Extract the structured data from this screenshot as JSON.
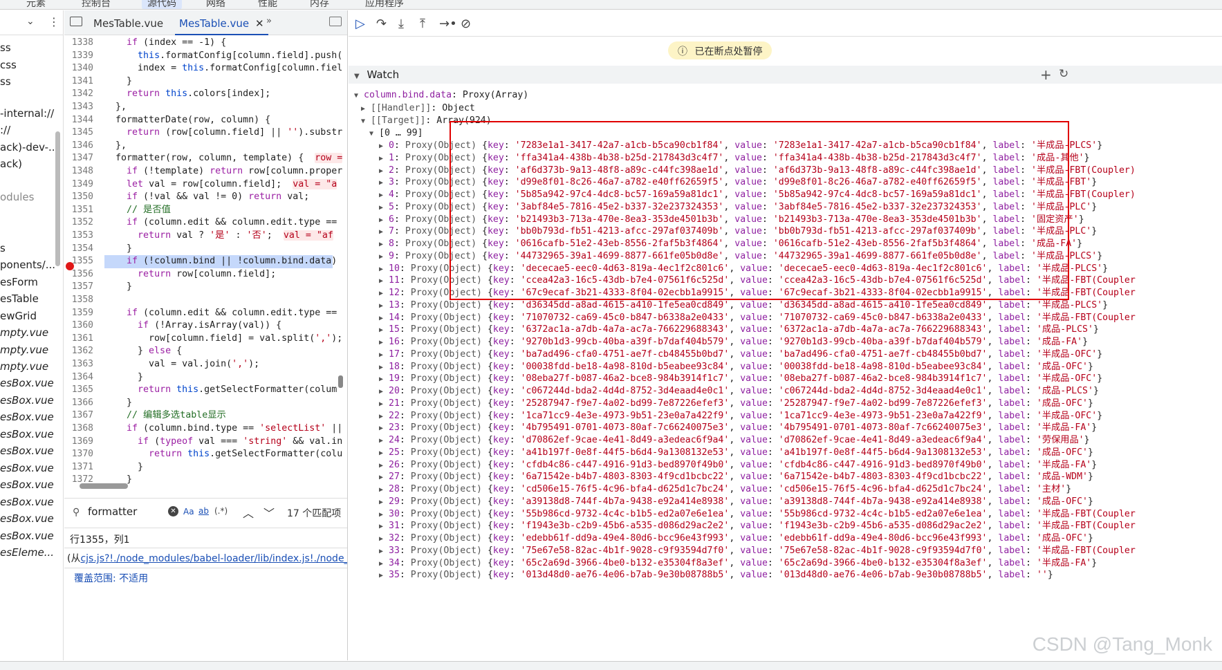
{
  "topbar": {
    "tabs": [
      "元素",
      "控制台",
      "源代码",
      "网络",
      "性能",
      "内存",
      "应用程序"
    ]
  },
  "file_tree": {
    "items": [
      "ss",
      "css",
      "ss",
      "-internal://",
      "://",
      "ack)-dev-...",
      "ack)",
      "odules",
      "s",
      "ponents/...",
      "esForm",
      "esTable",
      "ewGrid",
      "mpty.vue",
      "mpty.vue",
      "mpty.vue",
      "esBox.vue",
      "esBox.vue",
      "esBox.vue",
      "esBox.vue",
      "esBox.vue",
      "esBox.vue",
      "esBox.vue",
      "esBox.vue",
      "esBox.vue",
      "esBox.vue",
      "esEleme..."
    ]
  },
  "editor": {
    "tabs": [
      "MesTable.vue",
      "MesTable.vue"
    ],
    "lines": [
      [
        "1338",
        "    if (index == -1) {"
      ],
      [
        "1339",
        "      this.formatConfig[column.field].push("
      ],
      [
        "1340",
        "      index = this.formatConfig[column.fiel"
      ],
      [
        "1341",
        "    }"
      ],
      [
        "1342",
        "    return this.colors[index];"
      ],
      [
        "1343",
        "  },"
      ],
      [
        "1344",
        "  formatterDate(row, column) {"
      ],
      [
        "1345",
        "    return (row[column.field] || '').substr"
      ],
      [
        "1346",
        "  },"
      ],
      [
        "1347",
        "  formatter(row, column, template) {  row ="
      ],
      [
        "1348",
        "    if (!template) return row[column.proper"
      ],
      [
        "1349",
        "    let val = row[column.field];  val = \"a"
      ],
      [
        "1350",
        "    if (!val && val != 0) return val;"
      ],
      [
        "1351",
        "    // 是否值"
      ],
      [
        "1352",
        "    if (column.edit && column.edit.type =="
      ],
      [
        "1353",
        "      return val ? '是' : '否';  val = \"af"
      ],
      [
        "1354",
        "    }"
      ],
      [
        "1355",
        "    if (!column.bind || !column.bind.data)"
      ],
      [
        "1356",
        "      return row[column.field];"
      ],
      [
        "1357",
        "    }"
      ],
      [
        "1358",
        ""
      ],
      [
        "1359",
        "    if (column.edit && column.edit.type =="
      ],
      [
        "1360",
        "      if (!Array.isArray(val)) {"
      ],
      [
        "1361",
        "        row[column.field] = val.split(',');"
      ],
      [
        "1362",
        "      } else {"
      ],
      [
        "1363",
        "        val = val.join(',');"
      ],
      [
        "1364",
        "      }"
      ],
      [
        "1365",
        "      return this.getSelectFormatter(colum"
      ],
      [
        "1366",
        "    }"
      ],
      [
        "1367",
        "    // 编辑多选table显示"
      ],
      [
        "1368",
        "    if (column.bind.type == 'selectList' ||"
      ],
      [
        "1369",
        "      if (typeof val === 'string' && val.in"
      ],
      [
        "1370",
        "        return this.getSelectFormatter(colu"
      ],
      [
        "1371",
        "      }"
      ],
      [
        "1372",
        "    }"
      ]
    ],
    "search": {
      "query": "formatter",
      "aa": "Aa",
      "ab": "ab",
      "regex": "(.*)",
      "count": "17 个匹配项"
    },
    "status_pos": "行1355，列1",
    "status_src_prefix": "(从",
    "status_src": "cjs.js?!./node_modules/babel-loader/lib/index.js!./node_mo",
    "coverage": "覆盖范围: 不适用"
  },
  "debugger": {
    "paused": "已在断点处暂停",
    "watch_title": "Watch",
    "expr": "column.bind.data",
    "expr_type": "Proxy(Array)",
    "handler": "[[Handler]]",
    "handler_type": "Object",
    "target": "[[Target]]",
    "target_type": "Array(924)",
    "range": "[0 … 99]",
    "entries": [
      [
        "0",
        "7283e1a1-3417-42a7-a1cb-b5ca90cb1f84",
        "半成品-PLCS"
      ],
      [
        "1",
        "ffa341a4-438b-4b38-b25d-217843d3c4f7",
        "成品-其他"
      ],
      [
        "2",
        "af6d373b-9a13-48f8-a89c-c44fc398ae1d",
        "半成品-FBT(Coupler)"
      ],
      [
        "3",
        "d99e8f01-8c26-46a7-a782-e40ff62659f5",
        "半成品-FBT"
      ],
      [
        "4",
        "5b85a942-97c4-4dc8-bc57-169a59a81dc1",
        "半成品-FBT(Coupler)"
      ],
      [
        "5",
        "3abf84e5-7816-45e2-b337-32e237324353",
        "半成品-PLC"
      ],
      [
        "6",
        "b21493b3-713a-470e-8ea3-353de4501b3b",
        "固定资产"
      ],
      [
        "7",
        "bb0b793d-fb51-4213-afcc-297af037409b",
        "半成品-PLC"
      ],
      [
        "8",
        "0616cafb-51e2-43eb-8556-2faf5b3f4864",
        "成品-FA"
      ],
      [
        "9",
        "44732965-39a1-4699-8877-661fe05b0d8e",
        "半成品-PLCS"
      ],
      [
        "10",
        "dececae5-eec0-4d63-819a-4ec1f2c801c6",
        "半成品-PLCS"
      ],
      [
        "11",
        "ccea42a3-16c5-43db-b7e4-07561f6c525d",
        "半成品-FBT(Coupler"
      ],
      [
        "12",
        "67c9ecaf-3b21-4333-8f04-02ecbb1a9915",
        "半成品-FBT(Coupler"
      ],
      [
        "13",
        "d36345dd-a8ad-4615-a410-1fe5ea0cd849",
        "半成品-PLCS"
      ],
      [
        "14",
        "71070732-ca69-45c0-b847-b6338a2e0433",
        "半成品-FBT(Coupler"
      ],
      [
        "15",
        "6372ac1a-a7db-4a7a-ac7a-766229688343",
        "成品-PLCS"
      ],
      [
        "16",
        "9270b1d3-99cb-40ba-a39f-b7daf404b579",
        "成品-FA"
      ],
      [
        "17",
        "ba7ad496-cfa0-4751-ae7f-cb48455b0bd7",
        "半成品-OFC"
      ],
      [
        "18",
        "00038fdd-be18-4a98-810d-b5eabee93c84",
        "成品-OFC"
      ],
      [
        "19",
        "08eba27f-b087-46a2-bce8-984b3914f1c7",
        "半成品-OFC"
      ],
      [
        "20",
        "c067244d-bda2-4d4d-8752-3d4eaad4e0c1",
        "成品-PLCS"
      ],
      [
        "21",
        "25287947-f9e7-4a02-bd99-7e87226efef3",
        "成品-OFC"
      ],
      [
        "22",
        "1ca71cc9-4e3e-4973-9b51-23e0a7a422f9",
        "半成品-OFC"
      ],
      [
        "23",
        "4b795491-0701-4073-80af-7c66240075e3",
        "半成品-FA"
      ],
      [
        "24",
        "d70862ef-9cae-4e41-8d49-a3edeac6f9a4",
        "劳保用品"
      ],
      [
        "25",
        "a41b197f-0e8f-44f5-b6d4-9a1308132e53",
        "成品-OFC"
      ],
      [
        "26",
        "cfdb4c86-c447-4916-91d3-bed8970f49b0",
        "半成品-FA"
      ],
      [
        "27",
        "6a71542e-b4b7-4803-8303-4f9cd1bcbc22",
        "成品-WDM"
      ],
      [
        "28",
        "cd506e15-76f5-4c96-bfa4-d625d1c7bc24",
        "主材"
      ],
      [
        "29",
        "a39138d8-744f-4b7a-9438-e92a414e8938",
        "成品-OFC"
      ],
      [
        "30",
        "55b986cd-9732-4c4c-b1b5-ed2a07e6e1ea",
        "半成品-FBT(Coupler"
      ],
      [
        "31",
        "f1943e3b-c2b9-45b6-a535-d086d29ac2e2",
        "半成品-FBT(Coupler"
      ],
      [
        "32",
        "edebb61f-dd9a-49e4-80d6-bcc96e43f993",
        "成品-OFC"
      ],
      [
        "33",
        "75e67e58-82ac-4b1f-9028-c9f93594d7f0",
        "半成品-FBT(Coupler"
      ],
      [
        "34",
        "65c2a69d-3966-4be0-b132-e35304f8a3ef",
        "半成品-FA"
      ],
      [
        "35",
        "013d48d0-ae76-4e06-b7ab-9e30b08788b5",
        ""
      ]
    ]
  },
  "watermark": "CSDN @Tang_Monk"
}
